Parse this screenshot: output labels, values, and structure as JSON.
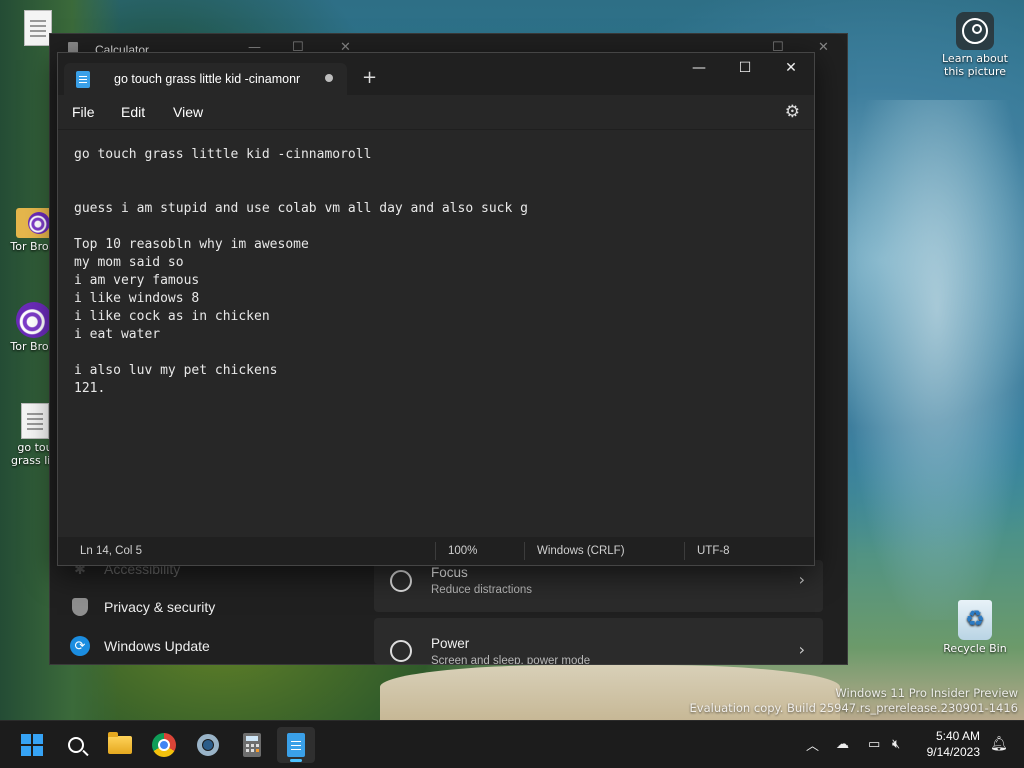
{
  "desktop": {
    "icons": [
      {
        "label": "",
        "type": "file"
      },
      {
        "label": "Tor Brow",
        "type": "tor-folder"
      },
      {
        "label": "Tor Brow",
        "type": "tor"
      },
      {
        "label": "go tou grass litt",
        "type": "file"
      }
    ],
    "learn_picture": "Learn about this picture",
    "recycle_bin": "Recycle Bin",
    "watermark_line1": "Windows 11 Pro Insider Preview",
    "watermark_line2": "Evaluation copy. Build 25947.rs_prerelease.230901-1416"
  },
  "calculator_window": {
    "title": "Calculator",
    "settings_nav": [
      {
        "label": "Accessibility"
      },
      {
        "label": "Privacy & security",
        "icon": "shield-icon"
      },
      {
        "label": "Windows Update",
        "icon": "update-icon"
      }
    ],
    "cards": [
      {
        "title": "Focus",
        "subtitle": "Reduce distractions",
        "icon": "focus-icon"
      },
      {
        "title": "Power",
        "subtitle": "Screen and sleep, power mode",
        "icon": "power-icon"
      }
    ]
  },
  "notepad": {
    "tab_title": "go touch grass little kid -cinamonr",
    "menus": [
      "File",
      "Edit",
      "View"
    ],
    "lines": [
      "go touch grass little kid -cinnamoroll",
      "",
      "",
      "guess i am stupid and use colab vm all day and also suck g",
      "",
      "Top 10 reasobln why im awesome",
      "my mom said so",
      "i am very famous",
      "i like windows 8",
      "i like cock as in chicken",
      "i eat water",
      "",
      "i also luv my pet chickens",
      "121."
    ],
    "status": {
      "position": "Ln 14, Col 5",
      "zoom": "100%",
      "line_ending": "Windows (CRLF)",
      "encoding": "UTF-8"
    }
  },
  "taskbar": {
    "time": "5:40 AM",
    "date": "9/14/2023",
    "accent": "#4cc2ff"
  }
}
